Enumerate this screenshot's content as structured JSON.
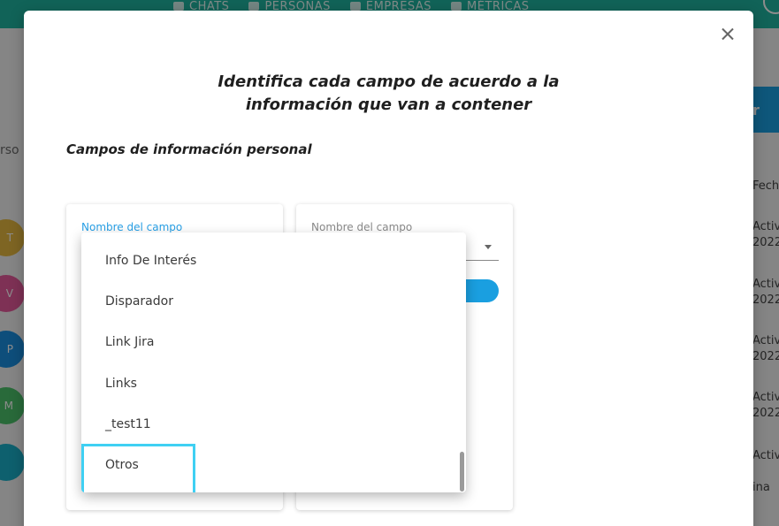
{
  "topnav": [
    "CHATS",
    "PERSONAS",
    "EMPRESAS",
    "MÉTRICAS"
  ],
  "background": {
    "left_label": "rso",
    "avatars": [
      {
        "letter": "T",
        "color": "#e5b941"
      },
      {
        "letter": "V",
        "color": "#e65a9c"
      },
      {
        "letter": "P",
        "color": "#1a8fe0"
      },
      {
        "letter": "M",
        "color": "#4cc26a"
      },
      {
        "letter": "",
        "color": "#1ab0c8"
      }
    ],
    "right_button": "r",
    "right_texts": [
      "Fech",
      "Activ",
      "2022",
      "Activ",
      "2022",
      "Activ",
      "2022",
      "Activ",
      "2022",
      "Activ",
      "ina"
    ]
  },
  "modal": {
    "title_line1": "Identifica cada campo de acuerdo a la",
    "title_line2": "información que van a contener",
    "section_title": "Campos de información personal",
    "field_label_1": "Nombre del campo",
    "field_label_2": "Nombre del campo"
  },
  "dropdown": {
    "items": [
      "Info De Interés",
      "Disparador",
      "Link Jira",
      "Links",
      "_test11",
      "Otros"
    ],
    "highlighted_index": 5
  },
  "colors": {
    "topbar": "#1fb5a0",
    "accent_blue": "#1a9fe0",
    "label_blue": "#29a0e6",
    "highlight_border": "#3fd0f3"
  }
}
